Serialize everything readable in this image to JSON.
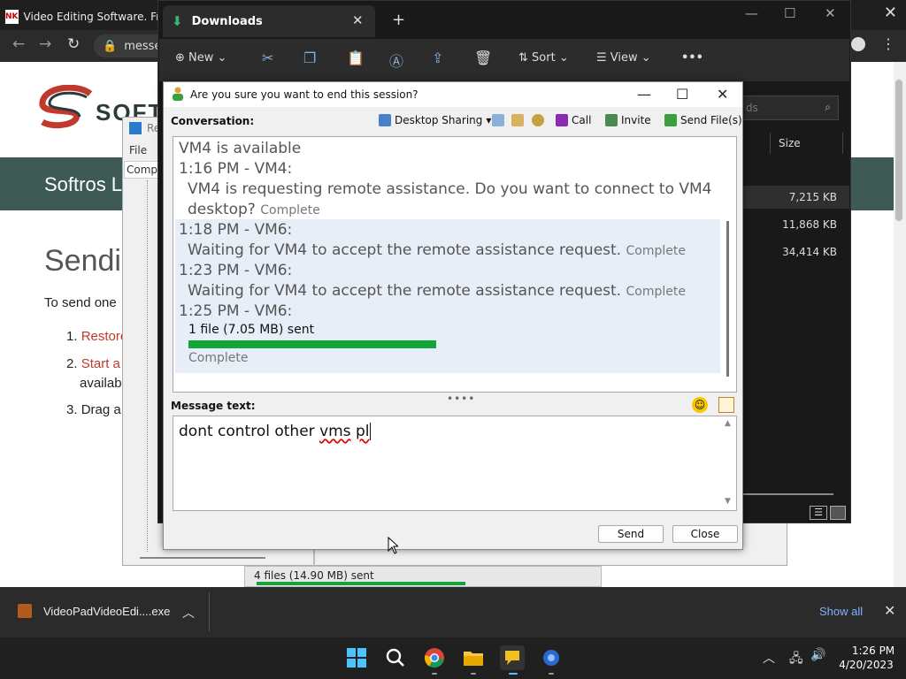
{
  "browser": {
    "tab_title": "Video Editing Software. Fr",
    "tab_icon_text": "NK",
    "address_text": "messe"
  },
  "webpage": {
    "logo_text": "SOFT",
    "band_title": "Softros L",
    "heading": "Sendi",
    "intro": "To send one",
    "steps": [
      {
        "num": "1.",
        "text": "Restore"
      },
      {
        "num": "2.",
        "text": "Start a",
        "line2": "availab"
      },
      {
        "num": "3.",
        "text": "Drag a"
      }
    ],
    "accent": "#c0392b"
  },
  "background_window": {
    "menu_file": "File",
    "comp_label": "Comp",
    "title_stub": "Re",
    "status_text": "4 files (14.90 MB) sent"
  },
  "explorer": {
    "tab_title": "Downloads",
    "toolbar": {
      "new_label": "New",
      "sort_label": "Sort",
      "view_label": "View"
    },
    "search_placeholder": "ds",
    "size_header": "Size",
    "sizes": [
      "7,215 KB",
      "11,868 KB",
      "34,414 KB"
    ]
  },
  "dialog": {
    "title": "Are you sure you want to end this session?",
    "conversation_label": "Conversation:",
    "toolbar": {
      "desktop_sharing": "Desktop Sharing",
      "call": "Call",
      "invite": "Invite",
      "send_files": "Send File(s)"
    },
    "conversation": [
      {
        "text": "VM4 is available"
      },
      {
        "text": "1:16 PM - VM4:"
      },
      {
        "text": "VM4 is requesting remote assistance. Do you want to connect to VM4"
      },
      {
        "text": "desktop?",
        "status": "Complete"
      },
      {
        "text": "1:18 PM - VM6:"
      },
      {
        "text": "Waiting for VM4 to accept the remote assistance request.",
        "status": "Complete"
      },
      {
        "text": "1:23 PM - VM6:"
      },
      {
        "text": "Waiting for VM4 to accept the remote assistance request.",
        "status": "Complete"
      },
      {
        "text": "1:25 PM - VM6:"
      }
    ],
    "file_transfer": {
      "text": "1 file (7.05 MB) sent",
      "progress": 1.0,
      "status": "Complete"
    },
    "message_label": "Message text:",
    "message": {
      "plain1": "dont control other ",
      "squiggle1": "vms",
      "space": " ",
      "squiggle2": "pl"
    },
    "send_label": "Send",
    "close_label": "Close"
  },
  "download_bar": {
    "filename": "VideoPadVideoEdi....exe",
    "show_all": "Show all"
  },
  "taskbar": {
    "time": "1:26 PM",
    "date": "4/20/2023"
  },
  "colors": {
    "progress": "#13a538",
    "link": "#7fb4ff",
    "band": "#3d5a55"
  }
}
